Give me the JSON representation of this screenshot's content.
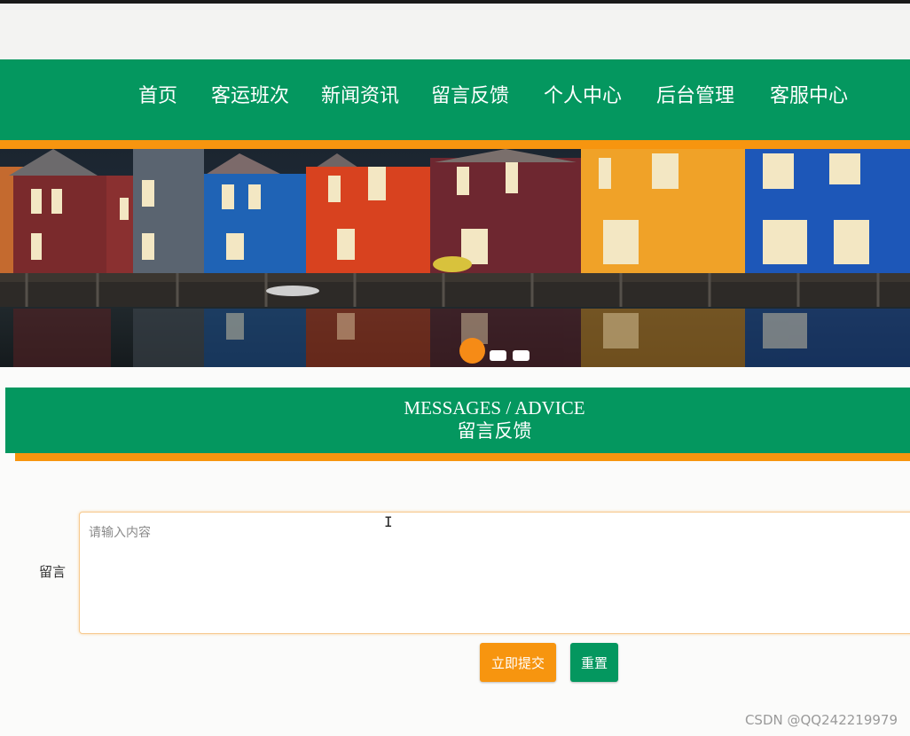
{
  "nav": {
    "items": [
      {
        "label": "首页"
      },
      {
        "label": "客运班次"
      },
      {
        "label": "新闻资讯"
      },
      {
        "label": "留言反馈"
      },
      {
        "label": "个人中心"
      },
      {
        "label": "后台管理"
      },
      {
        "label": "客服中心"
      }
    ]
  },
  "carousel": {
    "slide_count": 3,
    "active_index": 0
  },
  "section": {
    "title_en": "MESSAGES / ADVICE",
    "title_cn": "留言反馈"
  },
  "form": {
    "label": "留言",
    "placeholder": "请输入内容",
    "value": "",
    "submit_label": "立即提交",
    "reset_label": "重置"
  },
  "colors": {
    "brand_green": "#04975f",
    "accent_orange": "#f7950f"
  },
  "watermark": "CSDN @QQ242219979"
}
